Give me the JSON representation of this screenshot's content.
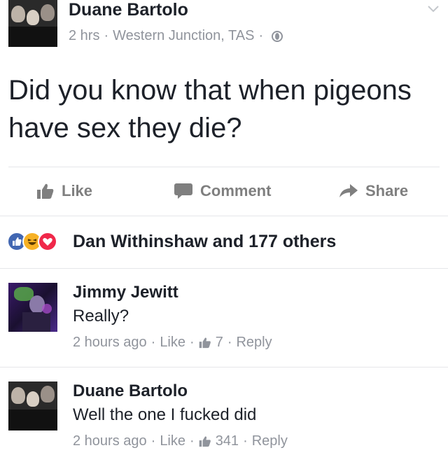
{
  "post": {
    "author": "Duane Bartolo",
    "time": "2 hrs",
    "location": "Western Junction, TAS",
    "separator": "·",
    "text": "Did you know that when pigeons have sex they die?",
    "privacy_icon": "globe-icon",
    "menu_icon": "chevron-down-icon"
  },
  "actions": {
    "like_label": "Like",
    "comment_label": "Comment",
    "share_label": "Share"
  },
  "reactions": {
    "icons": [
      "like-reaction-icon",
      "haha-reaction-icon",
      "love-reaction-icon"
    ],
    "text": "Dan Withinshaw and 177 others"
  },
  "comments": [
    {
      "author": "Jimmy Jewitt",
      "text": "Really?",
      "time": "2 hours ago",
      "like_label": "Like",
      "like_count": "7",
      "reply_label": "Reply"
    },
    {
      "author": "Duane Bartolo",
      "text": "Well the one I fucked did",
      "time": "2 hours ago",
      "like_label": "Like",
      "like_count": "341",
      "reply_label": "Reply"
    }
  ],
  "colors": {
    "text": "#1d2129",
    "meta": "#90949c",
    "action": "#7f7f7f",
    "like_blue": "#4267b2",
    "haha_yellow": "#f7b125",
    "love_red": "#f0284a",
    "divider": "#e5e6e9"
  }
}
